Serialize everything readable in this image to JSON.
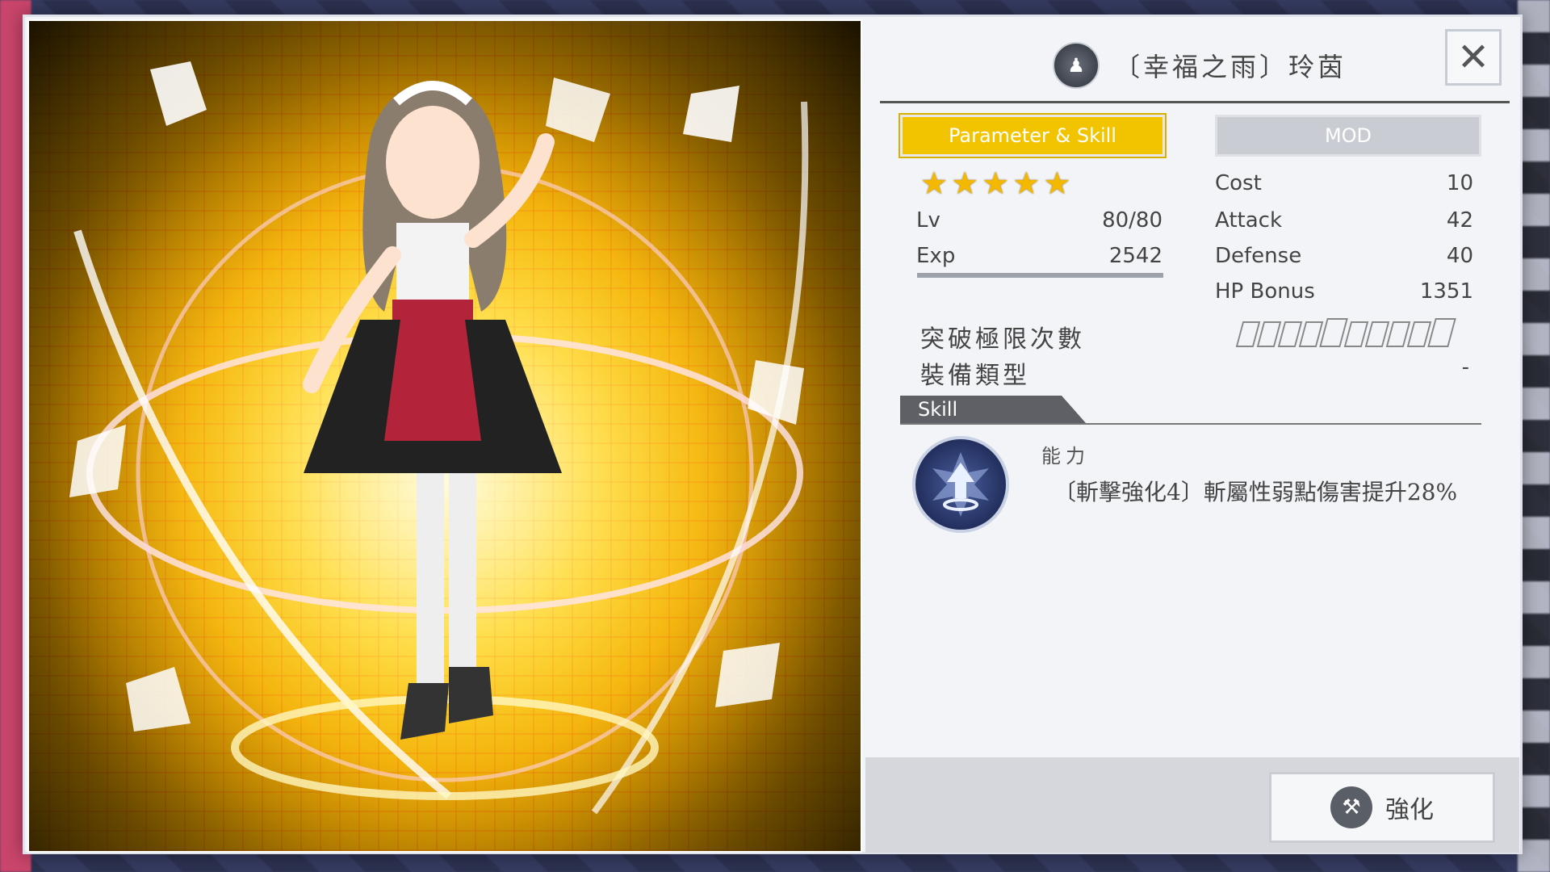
{
  "header": {
    "title": "〔幸福之雨〕玲茵",
    "title_icon": "chess-piece-icon",
    "close_label": "✕"
  },
  "tabs": {
    "parameter_skill": "Parameter & Skill",
    "mod": "MOD"
  },
  "stats_left": {
    "stars": 5,
    "lv_label": "Lv",
    "lv_value": "80/80",
    "exp_label": "Exp",
    "exp_value": "2542",
    "exp_progress": 1.0
  },
  "stats_right": {
    "cost_label": "Cost",
    "cost_value": "10",
    "attack_label": "Attack",
    "attack_value": "42",
    "defense_label": "Defense",
    "defense_value": "40",
    "hp_bonus_label": "HP Bonus",
    "hp_bonus_value": "1351"
  },
  "limit_break": {
    "label": "突破極限次數",
    "segments": 10,
    "filled": 0
  },
  "equipment_type": {
    "label": "裝備類型",
    "value": "-"
  },
  "skill": {
    "section_label": "Skill",
    "ability_label": "能力",
    "description": "〔斬擊強化4〕斬屬性弱點傷害提升28%",
    "icon": "arrow-up-burst-icon"
  },
  "footer": {
    "enhance_label": "強化",
    "enhance_icon": "hammer-icon"
  },
  "colors": {
    "accent": "#f2c400",
    "panel_bg": "#f3f4f7",
    "skill_tab": "#5f6066"
  }
}
